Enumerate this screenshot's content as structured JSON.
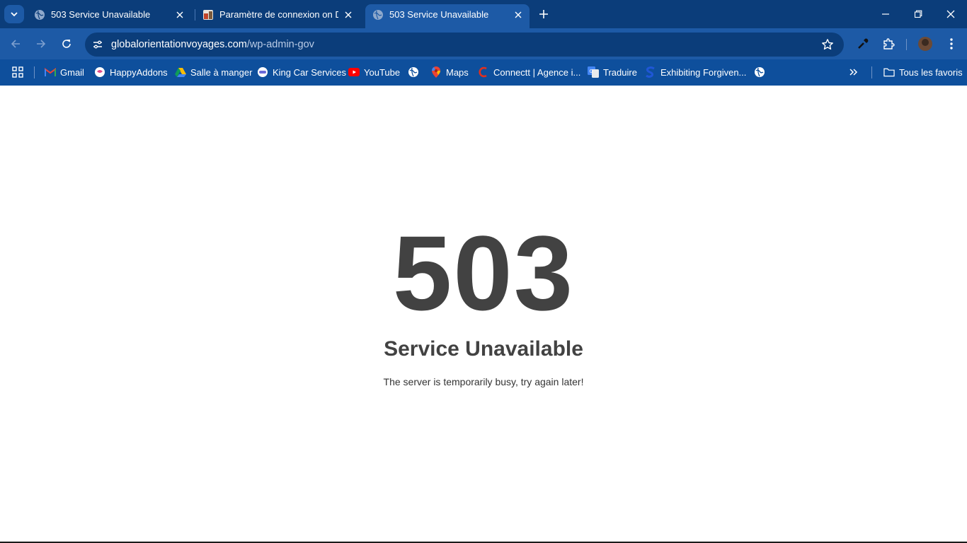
{
  "tabs": [
    {
      "title": "503 Service Unavailable",
      "active": false
    },
    {
      "title": "Paramètre de connexion on DEF",
      "active": false
    },
    {
      "title": "503 Service Unavailable",
      "active": true
    }
  ],
  "address_bar": {
    "host": "globalorientationvoyages.com",
    "path": "/wp-admin-gov"
  },
  "bookmarks": [
    {
      "label": "Gmail",
      "icon": "gmail-icon"
    },
    {
      "label": "HappyAddons",
      "icon": "happyaddons-icon"
    },
    {
      "label": "Salle à manger",
      "icon": "drive-icon"
    },
    {
      "label": "King Car Services",
      "icon": "kingcar-icon"
    },
    {
      "label": "YouTube",
      "icon": "youtube-icon"
    },
    {
      "label": "",
      "icon": "globe-icon"
    },
    {
      "label": "Maps",
      "icon": "maps-icon"
    },
    {
      "label": "Connectt | Agence i...",
      "icon": "connectt-icon"
    },
    {
      "label": "Traduire",
      "icon": "translate-icon"
    },
    {
      "label": "Exhibiting Forgiven...",
      "icon": "s-icon"
    },
    {
      "label": "",
      "icon": "globe-icon"
    }
  ],
  "all_bookmarks_label": "Tous les favoris",
  "page": {
    "code": "503",
    "heading": "Service Unavailable",
    "message": "The server is temporarily busy, try again later!"
  },
  "colors": {
    "tabstrip": "#0b3d7a",
    "toolbar": "#1d5aa6",
    "bookmarks_bar": "#0e4f9c",
    "error_text": "#424242"
  }
}
